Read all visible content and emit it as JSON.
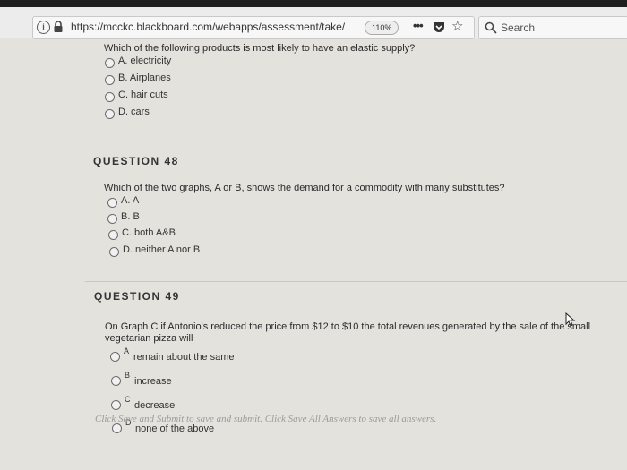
{
  "browser": {
    "url": "https://mcckc.blackboard.com/webapps/assessment/take/",
    "zoom": "110%",
    "search_placeholder": "Search"
  },
  "q47": {
    "text": "Which of the following products is most likely to have an elastic supply?",
    "options": [
      "A. electricity",
      "B. Airplanes",
      "C. hair cuts",
      "D. cars"
    ]
  },
  "q48": {
    "heading": "QUESTION 48",
    "text": "Which of the two graphs, A or B, shows the demand for a commodity with many substitutes?",
    "options": [
      "A. A",
      "B. B",
      "C. both A&B",
      "D. neither A nor B"
    ]
  },
  "q49": {
    "heading": "QUESTION 49",
    "text_line1": "On Graph C if Antonio's reduced the price from $12 to $10 the total revenues generated by the sale of the small",
    "text_line2": "vegetarian pizza will",
    "option_letters": [
      "A",
      "B",
      "C",
      "D"
    ],
    "options": [
      "remain about the same",
      "increase",
      "decrease",
      "none of the above"
    ]
  },
  "footer": "Click Save and Submit to save and submit. Click Save All Answers to save all answers."
}
